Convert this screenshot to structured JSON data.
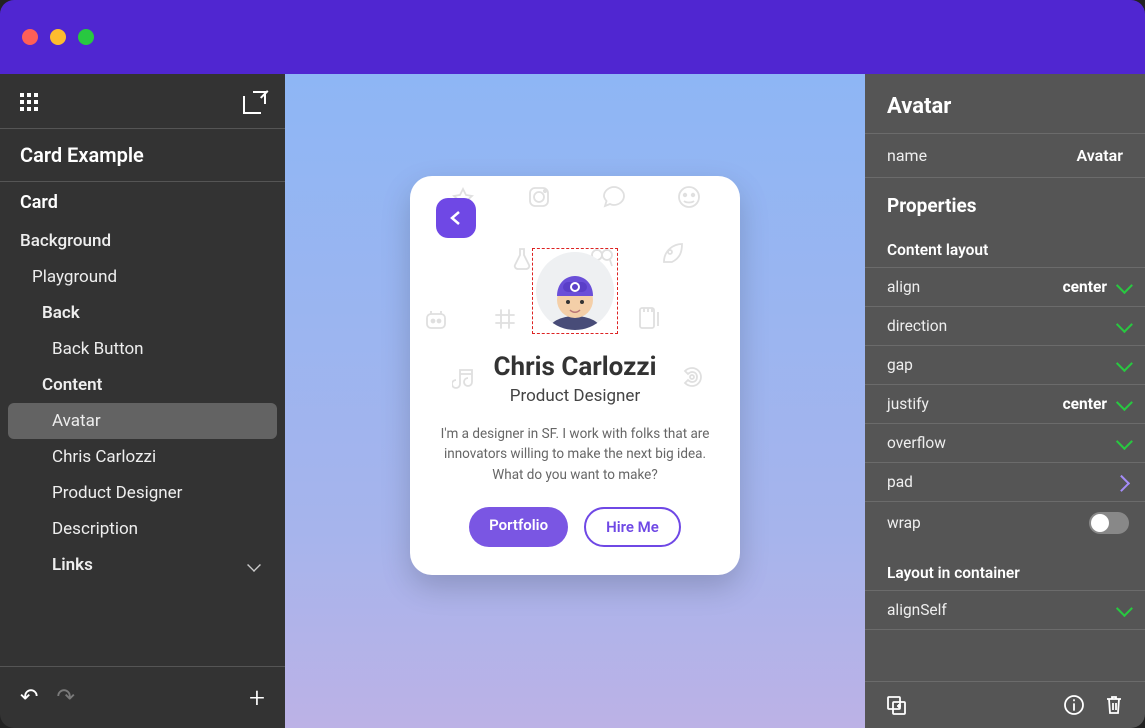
{
  "left": {
    "project_title": "Card Example",
    "root": "Card",
    "tree": {
      "background": "Background",
      "playground": "Playground",
      "back": "Back",
      "back_button": "Back Button",
      "content": "Content",
      "avatar": "Avatar",
      "name_item": "Chris Carlozzi",
      "role_item": "Product Designer",
      "description_item": "Description",
      "links": "Links"
    }
  },
  "card": {
    "name": "Chris Carlozzi",
    "role": "Product Designer",
    "description": "I'm a designer in SF. I work with folks that are innovators willing to make the next big idea. What do you want to make?",
    "portfolio_label": "Portfolio",
    "hire_label": "Hire Me"
  },
  "inspector": {
    "title": "Avatar",
    "name_label": "name",
    "name_value": "Avatar",
    "properties_heading": "Properties",
    "content_layout_heading": "Content layout",
    "props": {
      "align": {
        "label": "align",
        "value": "center"
      },
      "direction": {
        "label": "direction",
        "value": ""
      },
      "gap": {
        "label": "gap",
        "value": ""
      },
      "justify": {
        "label": "justify",
        "value": "center"
      },
      "overflow": {
        "label": "overflow",
        "value": ""
      },
      "pad": {
        "label": "pad",
        "value": ""
      },
      "wrap": {
        "label": "wrap",
        "value": ""
      }
    },
    "layout_in_container_heading": "Layout in container",
    "alignSelf": {
      "label": "alignSelf",
      "value": ""
    }
  }
}
